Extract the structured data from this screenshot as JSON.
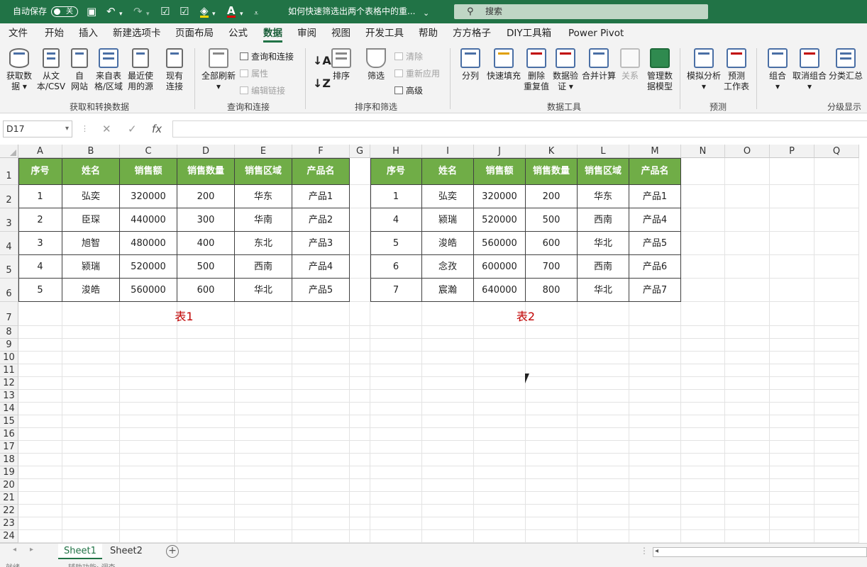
{
  "titlebar": {
    "autosave_label": "自动保存",
    "autosave_state": "关",
    "doc_title": "如何快速筛选出两个表格中的重...",
    "search_placeholder": "搜索"
  },
  "menu_tabs": [
    "文件",
    "开始",
    "插入",
    "新建选项卡",
    "页面布局",
    "公式",
    "数据",
    "审阅",
    "视图",
    "开发工具",
    "帮助",
    "方方格子",
    "DIY工具箱",
    "Power Pivot"
  ],
  "active_tab": "数据",
  "ribbon": {
    "get_transform": {
      "label": "获取和转换数据",
      "buttons": [
        "获取数\n据 ▾",
        "从文\n本/CSV",
        "自\n网站",
        "来自表\n格/区域",
        "最近使\n用的源",
        "现有\n连接"
      ]
    },
    "queries": {
      "label": "查询和连接",
      "refresh": "全部刷新\n▾",
      "items": [
        "查询和连接",
        "属性",
        "编辑链接"
      ]
    },
    "sort_filter": {
      "label": "排序和筛选",
      "sort": "排序",
      "filter": "筛选",
      "items": [
        "清除",
        "重新应用",
        "高级"
      ]
    },
    "data_tools": {
      "label": "数据工具",
      "buttons": [
        "分列",
        "快速填充",
        "删除\n重复值",
        "数据验\n证 ▾",
        "合并计算",
        "关系",
        "管理数\n据模型"
      ]
    },
    "forecast": {
      "label": "预测",
      "buttons": [
        "模拟分析\n▾",
        "预测\n工作表"
      ]
    },
    "outline": {
      "label": "分级显示",
      "buttons": [
        "组合\n▾",
        "取消组合\n▾",
        "分类汇总"
      ]
    }
  },
  "formula_bar": {
    "name_box": "D17",
    "fx": "fx",
    "formula": ""
  },
  "columns": [
    "A",
    "B",
    "C",
    "D",
    "E",
    "F",
    "G",
    "H",
    "I",
    "J",
    "K",
    "L",
    "M",
    "N",
    "O",
    "P",
    "Q"
  ],
  "rows": [
    "1",
    "2",
    "3",
    "4",
    "5",
    "6",
    "7",
    "8",
    "9",
    "10",
    "11",
    "12",
    "13",
    "14",
    "15",
    "16",
    "17",
    "18",
    "19",
    "20",
    "21",
    "22",
    "23",
    "24"
  ],
  "table1": {
    "headers": [
      "序号",
      "姓名",
      "销售额",
      "销售数量",
      "销售区域",
      "产品名"
    ],
    "rows": [
      [
        "1",
        "弘奕",
        "320000",
        "200",
        "华东",
        "产品1"
      ],
      [
        "2",
        "臣琛",
        "440000",
        "300",
        "华南",
        "产品2"
      ],
      [
        "3",
        "旭智",
        "480000",
        "400",
        "东北",
        "产品3"
      ],
      [
        "4",
        "颍瑞",
        "520000",
        "500",
        "西南",
        "产品4"
      ],
      [
        "5",
        "浚皓",
        "560000",
        "600",
        "华北",
        "产品5"
      ]
    ],
    "caption": "表1"
  },
  "table2": {
    "headers": [
      "序号",
      "姓名",
      "销售额",
      "销售数量",
      "销售区域",
      "产品名"
    ],
    "rows": [
      [
        "1",
        "弘奕",
        "320000",
        "200",
        "华东",
        "产品1"
      ],
      [
        "4",
        "颍瑞",
        "520000",
        "500",
        "西南",
        "产品4"
      ],
      [
        "5",
        "浚皓",
        "560000",
        "600",
        "华北",
        "产品5"
      ],
      [
        "6",
        "念孜",
        "600000",
        "700",
        "西南",
        "产品6"
      ],
      [
        "7",
        "宸瀚",
        "640000",
        "800",
        "华北",
        "产品7"
      ]
    ],
    "caption": "表2"
  },
  "sheets": [
    "Sheet1",
    "Sheet2"
  ],
  "active_sheet": "Sheet1",
  "status": {
    "ready": "就绪",
    "accessibility": "辅助功能: 调查"
  },
  "colors": {
    "accent": "#217346",
    "table_header": "#70ad47",
    "caption": "#c00000"
  }
}
